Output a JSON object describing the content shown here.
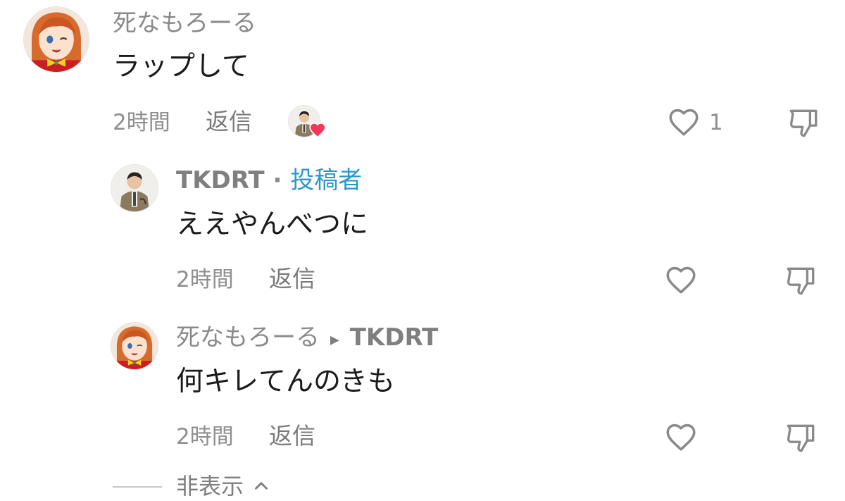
{
  "comments": [
    {
      "username": "死なもろーる",
      "text": "ラップして",
      "time": "2時間",
      "reply_label": "返信",
      "like_count": "1",
      "liked_by_creator": true
    },
    {
      "username": "TKDRT",
      "separator": "·",
      "badge": "投稿者",
      "text": "ええやんべつに",
      "time": "2時間",
      "reply_label": "返信"
    },
    {
      "username": "死なもろーる",
      "reply_to_arrow": "▸",
      "reply_to": "TKDRT",
      "text": "何キレてんのきも",
      "time": "2時間",
      "reply_label": "返信"
    }
  ],
  "hide_replies": {
    "label": "非表示",
    "icon": "chevron-up-icon"
  },
  "colors": {
    "creator_badge": "#2d97c9",
    "liked_heart": "#f5365c",
    "text": "#1b1b1b",
    "muted": "#8f8f8f"
  }
}
